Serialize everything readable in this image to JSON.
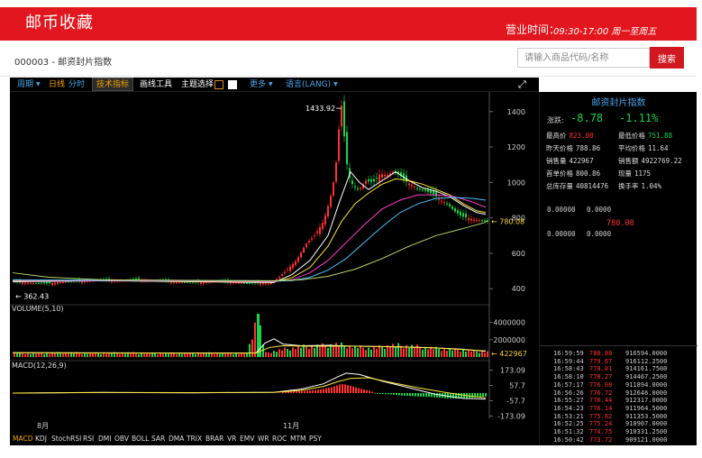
{
  "header": {
    "brand": "邮币收藏",
    "hours_label": "营业时间：",
    "hours_value": "09:30-17:00 周一至周五"
  },
  "product": {
    "title": "000003 - 邮资封片指数"
  },
  "search": {
    "placeholder": "请输入商品代码/名称",
    "button": "搜索"
  },
  "toolbar": {
    "period": "周期",
    "daily": "日线",
    "timeshare": "分时",
    "indicators": "技术指标",
    "draw_tools": "画线工具",
    "theme": "主题选择",
    "more": "更多",
    "language": "语言(LANG)",
    "theme_colors": [
      "#e08a1e",
      "#ffffff"
    ]
  },
  "chart_data": [
    {
      "type": "candlestick",
      "x_labels": [
        "8月",
        "11月"
      ],
      "y_ticks": [
        1400,
        1200,
        1000,
        800,
        600,
        400
      ],
      "ylim": [
        330,
        1470
      ],
      "annotations": {
        "high": "1433.92",
        "low": "362.43",
        "last": "780.08"
      },
      "close_path": [
        [
          0,
          440
        ],
        [
          20,
          432
        ],
        [
          40,
          430
        ],
        [
          60,
          440
        ],
        [
          80,
          445
        ],
        [
          100,
          448
        ],
        [
          120,
          446
        ],
        [
          140,
          452
        ],
        [
          160,
          446
        ],
        [
          180,
          440
        ],
        [
          200,
          435
        ],
        [
          215,
          438
        ],
        [
          230,
          442
        ],
        [
          245,
          438
        ],
        [
          260,
          430
        ],
        [
          275,
          432
        ],
        [
          285,
          428
        ],
        [
          295,
          462
        ],
        [
          305,
          510
        ],
        [
          315,
          560
        ],
        [
          325,
          650
        ],
        [
          335,
          700
        ],
        [
          345,
          780
        ],
        [
          352,
          900
        ],
        [
          358,
          1050
        ],
        [
          362,
          1300
        ],
        [
          365,
          1433.92
        ],
        [
          368,
          1260
        ],
        [
          372,
          1050
        ],
        [
          378,
          980
        ],
        [
          385,
          960
        ],
        [
          392,
          1010
        ],
        [
          400,
          1000
        ],
        [
          408,
          1050
        ],
        [
          415,
          1040
        ],
        [
          422,
          1060
        ],
        [
          430,
          1040
        ],
        [
          438,
          1000
        ],
        [
          445,
          980
        ],
        [
          452,
          960
        ],
        [
          460,
          950
        ],
        [
          468,
          930
        ],
        [
          475,
          900
        ],
        [
          482,
          880
        ],
        [
          490,
          840
        ],
        [
          498,
          810
        ],
        [
          505,
          800
        ],
        [
          512,
          790
        ],
        [
          519,
          785
        ],
        [
          525,
          780.08
        ]
      ],
      "ma": [
        {
          "color": "#ffffff",
          "points": [
            [
              0,
              440
            ],
            [
              100,
              445
            ],
            [
              200,
              440
            ],
            [
              290,
              435
            ],
            [
              310,
              480
            ],
            [
              330,
              560
            ],
            [
              350,
              700
            ],
            [
              362,
              880
            ],
            [
              375,
              1060
            ],
            [
              385,
              1000
            ],
            [
              395,
              960
            ],
            [
              410,
              1010
            ],
            [
              425,
              1060
            ],
            [
              440,
              1010
            ],
            [
              455,
              970
            ],
            [
              470,
              950
            ],
            [
              485,
              920
            ],
            [
              500,
              870
            ],
            [
              515,
              830
            ],
            [
              525,
              820
            ]
          ]
        },
        {
          "color": "#ffe83a",
          "points": [
            [
              0,
              445
            ],
            [
              100,
              447
            ],
            [
              200,
              442
            ],
            [
              290,
              438
            ],
            [
              310,
              462
            ],
            [
              330,
              520
            ],
            [
              350,
              640
            ],
            [
              365,
              780
            ],
            [
              380,
              880
            ],
            [
              395,
              940
            ],
            [
              410,
              990
            ],
            [
              425,
              1020
            ],
            [
              440,
              1010
            ],
            [
              455,
              990
            ],
            [
              470,
              960
            ],
            [
              485,
              930
            ],
            [
              500,
              880
            ],
            [
              515,
              840
            ],
            [
              525,
              830
            ]
          ]
        },
        {
          "color": "#ff3cc8",
          "points": [
            [
              0,
              448
            ],
            [
              100,
              446
            ],
            [
              200,
              444
            ],
            [
              290,
              440
            ],
            [
              310,
              450
            ],
            [
              330,
              490
            ],
            [
              350,
              560
            ],
            [
              370,
              660
            ],
            [
              390,
              760
            ],
            [
              410,
              850
            ],
            [
              430,
              900
            ],
            [
              450,
              930
            ],
            [
              470,
              930
            ],
            [
              490,
              920
            ],
            [
              510,
              890
            ],
            [
              525,
              860
            ]
          ]
        },
        {
          "color": "#4cc0ff",
          "points": [
            [
              0,
              450
            ],
            [
              100,
              448
            ],
            [
              200,
              446
            ],
            [
              290,
              443
            ],
            [
              310,
              446
            ],
            [
              330,
              465
            ],
            [
              350,
              505
            ],
            [
              370,
              570
            ],
            [
              390,
              660
            ],
            [
              410,
              750
            ],
            [
              430,
              830
            ],
            [
              450,
              880
            ],
            [
              470,
              910
            ],
            [
              490,
              915
            ],
            [
              510,
              910
            ],
            [
              525,
              900
            ]
          ]
        },
        {
          "color": "#b9d96a",
          "points": [
            [
              0,
              490
            ],
            [
              40,
              465
            ],
            [
              100,
              450
            ],
            [
              200,
              447
            ],
            [
              290,
              445
            ],
            [
              320,
              450
            ],
            [
              350,
              470
            ],
            [
              380,
              510
            ],
            [
              410,
              570
            ],
            [
              440,
              640
            ],
            [
              470,
              700
            ],
            [
              500,
              740
            ],
            [
              525,
              775
            ]
          ]
        }
      ]
    },
    {
      "type": "bar",
      "title": "VOLUME(5,10)",
      "y_ticks": [
        4000000,
        2000000
      ],
      "y_tick_labels": [
        "4000000",
        "2000000"
      ],
      "last_label": "422967",
      "ylim": [
        0,
        5000000
      ],
      "bars": [
        [
          0,
          500000
        ],
        [
          20,
          430000
        ],
        [
          40,
          460000
        ],
        [
          60,
          520000
        ],
        [
          80,
          480000
        ],
        [
          100,
          440000
        ],
        [
          120,
          500000
        ],
        [
          140,
          470000
        ],
        [
          160,
          430000
        ],
        [
          180,
          460000
        ],
        [
          200,
          420000
        ],
        [
          220,
          470000
        ],
        [
          240,
          450000
        ],
        [
          260,
          430000
        ],
        [
          272,
          5000000
        ],
        [
          280,
          470000
        ],
        [
          300,
          900000
        ],
        [
          320,
          1200000
        ],
        [
          340,
          1300000
        ],
        [
          360,
          1500000
        ],
        [
          380,
          1200000
        ],
        [
          400,
          1000000
        ],
        [
          420,
          1400000
        ],
        [
          440,
          1300000
        ],
        [
          460,
          1100000
        ],
        [
          480,
          900000
        ],
        [
          500,
          800000
        ],
        [
          520,
          600000
        ]
      ],
      "ma5": [
        [
          0,
          500000
        ],
        [
          100,
          480000
        ],
        [
          200,
          460000
        ],
        [
          270,
          470000
        ],
        [
          280,
          1600000
        ],
        [
          290,
          2100000
        ],
        [
          300,
          1500000
        ],
        [
          320,
          1300000
        ],
        [
          350,
          1350000
        ],
        [
          380,
          1250000
        ],
        [
          420,
          1200000
        ],
        [
          460,
          1100000
        ],
        [
          500,
          900000
        ],
        [
          525,
          650000
        ]
      ],
      "ma10": [
        [
          0,
          490000
        ],
        [
          100,
          470000
        ],
        [
          200,
          455000
        ],
        [
          270,
          460000
        ],
        [
          285,
          1100000
        ],
        [
          300,
          1300000
        ],
        [
          330,
          1250000
        ],
        [
          370,
          1260000
        ],
        [
          420,
          1180000
        ],
        [
          470,
          1050000
        ],
        [
          525,
          700000
        ]
      ]
    },
    {
      "type": "macd",
      "title": "MACD(12,26,9)",
      "y_ticks": [
        173.09,
        57.7,
        -57.7,
        -173.09
      ],
      "y_tick_labels": [
        "173.09",
        "57.7",
        "-57.7",
        "-173.09"
      ],
      "ylim": [
        -190,
        190
      ],
      "dif": [
        [
          0,
          0
        ],
        [
          100,
          5
        ],
        [
          200,
          2
        ],
        [
          290,
          6
        ],
        [
          320,
          30
        ],
        [
          345,
          70
        ],
        [
          360,
          120
        ],
        [
          370,
          150
        ],
        [
          385,
          140
        ],
        [
          410,
          90
        ],
        [
          440,
          40
        ],
        [
          470,
          -10
        ],
        [
          500,
          -40
        ],
        [
          525,
          -45
        ]
      ],
      "dea": [
        [
          0,
          0
        ],
        [
          100,
          4
        ],
        [
          200,
          3
        ],
        [
          290,
          5
        ],
        [
          320,
          20
        ],
        [
          345,
          50
        ],
        [
          360,
          85
        ],
        [
          375,
          110
        ],
        [
          395,
          115
        ],
        [
          420,
          80
        ],
        [
          450,
          40
        ],
        [
          480,
          5
        ],
        [
          510,
          -25
        ],
        [
          525,
          -35
        ]
      ],
      "hist": [
        [
          300,
          10
        ],
        [
          320,
          15
        ],
        [
          340,
          25
        ],
        [
          355,
          45
        ],
        [
          365,
          70
        ],
        [
          375,
          55
        ],
        [
          385,
          35
        ],
        [
          395,
          20
        ],
        [
          405,
          -5
        ],
        [
          420,
          -10
        ],
        [
          435,
          -20
        ],
        [
          450,
          -25
        ],
        [
          465,
          -30
        ],
        [
          480,
          -38
        ],
        [
          495,
          -42
        ],
        [
          510,
          -35
        ],
        [
          525,
          -25
        ]
      ]
    }
  ],
  "side": {
    "title": "邮资封片指数",
    "change_label": "涨跌:",
    "change": "-8.78",
    "change_pct": "-1.11%",
    "stats": [
      {
        "label": "最高价",
        "value": "823.00",
        "value2_label": "最低价格",
        "value2": "751.88"
      },
      {
        "label": "昨天价格",
        "value": "788.86",
        "value2_label": "平均价格",
        "value2": "11.64"
      },
      {
        "label": "销售量",
        "value": "422967",
        "value2_label": "销售额",
        "value2": "4922769.22"
      },
      {
        "label": "首单价格",
        "value": "800.86",
        "value2_label": "现量",
        "value2": "1175"
      },
      {
        "label": "总库存量",
        "value": "40814476",
        "value2_label": "换手率",
        "value2": "1.04%"
      }
    ],
    "orderbook_top": {
      "a": "0.00000",
      "b": "0.0000"
    },
    "mid_price": "780.08",
    "orderbook_bottom": {
      "a": "0.00000",
      "b": "0.0000"
    },
    "trades": [
      {
        "time": "16:59:59",
        "price": "780.88",
        "amount": "916594.0000"
      },
      {
        "time": "16:59:44",
        "price": "779.67",
        "amount": "916112.2500"
      },
      {
        "time": "16:58:43",
        "price": "778.01",
        "amount": "914161.7500"
      },
      {
        "time": "16:58:10",
        "price": "778.27",
        "amount": "914467.2500"
      },
      {
        "time": "16:57:17",
        "price": "776.08",
        "amount": "911894.0000"
      },
      {
        "time": "16:56:26",
        "price": "776.72",
        "amount": "912646.0000"
      },
      {
        "time": "16:55:27",
        "price": "776.44",
        "amount": "912317.0000"
      },
      {
        "time": "16:54:23",
        "price": "776.14",
        "amount": "911964.5000"
      },
      {
        "time": "16:53:21",
        "price": "775.62",
        "amount": "911353.5000"
      },
      {
        "time": "16:52:25",
        "price": "775.24",
        "amount": "910907.0000"
      },
      {
        "time": "16:51:32",
        "price": "774.75",
        "amount": "910331.2500"
      },
      {
        "time": "16:50:42",
        "price": "773.72",
        "amount": "909121.0000"
      }
    ]
  },
  "indicator_tabs": [
    "MACD",
    "KDJ",
    "StochRSI",
    "RSI",
    "DMI",
    "OBV",
    "BOLL",
    "SAR",
    "DMA",
    "TRIX",
    "BRAR",
    "VR",
    "EMV",
    "WR",
    "ROC",
    "MTM",
    "PSY"
  ],
  "colors": {
    "up": "#ff3030",
    "down": "#19d34a",
    "accent": "#e2161e",
    "active_tab": "#f5a300"
  }
}
